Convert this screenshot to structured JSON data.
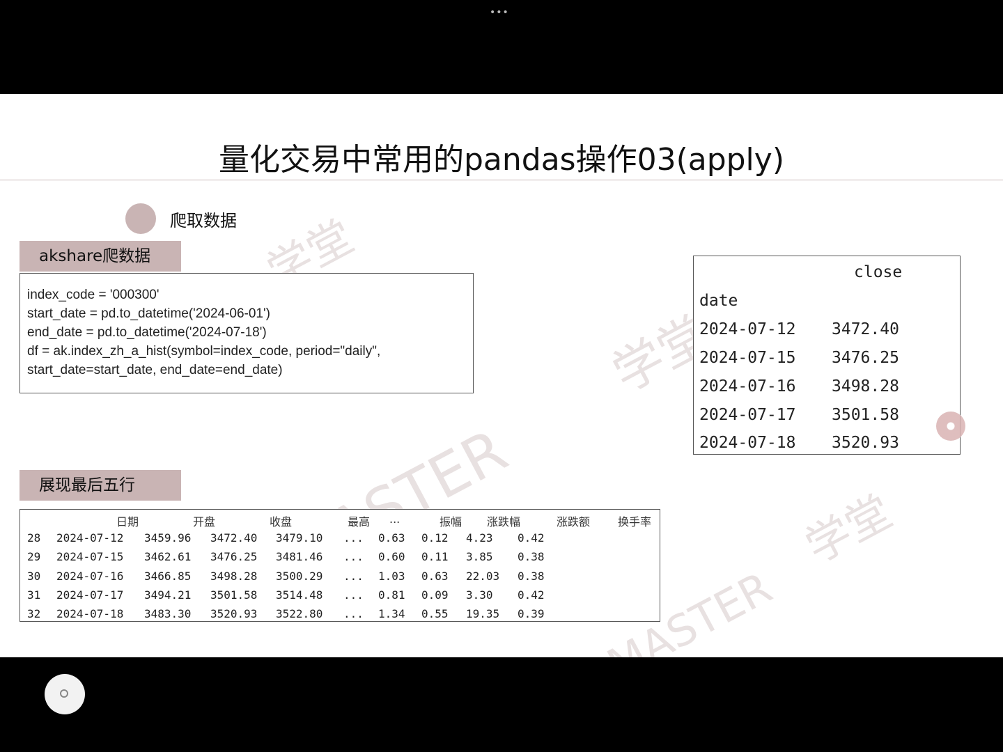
{
  "window": {
    "dots": "•••"
  },
  "slide": {
    "title": "量化交易中常用的pandas操作03(apply)",
    "bullet": "爬取数据",
    "tag_fetch": "akshare爬数据",
    "tag_tail": "展现最后五行",
    "code": [
      "index_code = '000300'",
      "start_date = pd.to_datetime('2024-06-01')",
      "end_date = pd.to_datetime('2024-07-18')",
      "df = ak.index_zh_a_hist(symbol=index_code, period=\"daily\",",
      "start_date=start_date, end_date=end_date)"
    ],
    "close_table": {
      "column": "close",
      "index_name": "date",
      "rows": [
        {
          "date": "2024-07-12",
          "close": "3472.40"
        },
        {
          "date": "2024-07-15",
          "close": "3476.25"
        },
        {
          "date": "2024-07-16",
          "close": "3498.28"
        },
        {
          "date": "2024-07-17",
          "close": "3501.58"
        },
        {
          "date": "2024-07-18",
          "close": "3520.93"
        }
      ]
    },
    "tail_table": {
      "headers": [
        "日期",
        "开盘",
        "收盘",
        "最高",
        "...",
        "振幅",
        "涨跌幅",
        "涨跌额",
        "换手率"
      ],
      "rows": [
        [
          "28",
          "2024-07-12",
          "3459.96",
          "3472.40",
          "3479.10",
          "...",
          "0.63",
          "0.12",
          "4.23",
          "0.42"
        ],
        [
          "29",
          "2024-07-15",
          "3462.61",
          "3476.25",
          "3481.46",
          "...",
          "0.60",
          "0.11",
          "3.85",
          "0.38"
        ],
        [
          "30",
          "2024-07-16",
          "3466.85",
          "3498.28",
          "3500.29",
          "...",
          "1.03",
          "0.63",
          "22.03",
          "0.38"
        ],
        [
          "31",
          "2024-07-17",
          "3494.21",
          "3501.58",
          "3514.48",
          "...",
          "0.81",
          "0.09",
          "3.30",
          "0.42"
        ],
        [
          "32",
          "2024-07-18",
          "3483.30",
          "3520.93",
          "3522.80",
          "...",
          "1.34",
          "0.55",
          "19.35",
          "0.39"
        ]
      ]
    },
    "watermarks": [
      "学堂",
      "学堂",
      "MASTER",
      "学堂",
      "MASTER"
    ],
    "nav": {
      "prev": "‹",
      "next": "›"
    }
  }
}
